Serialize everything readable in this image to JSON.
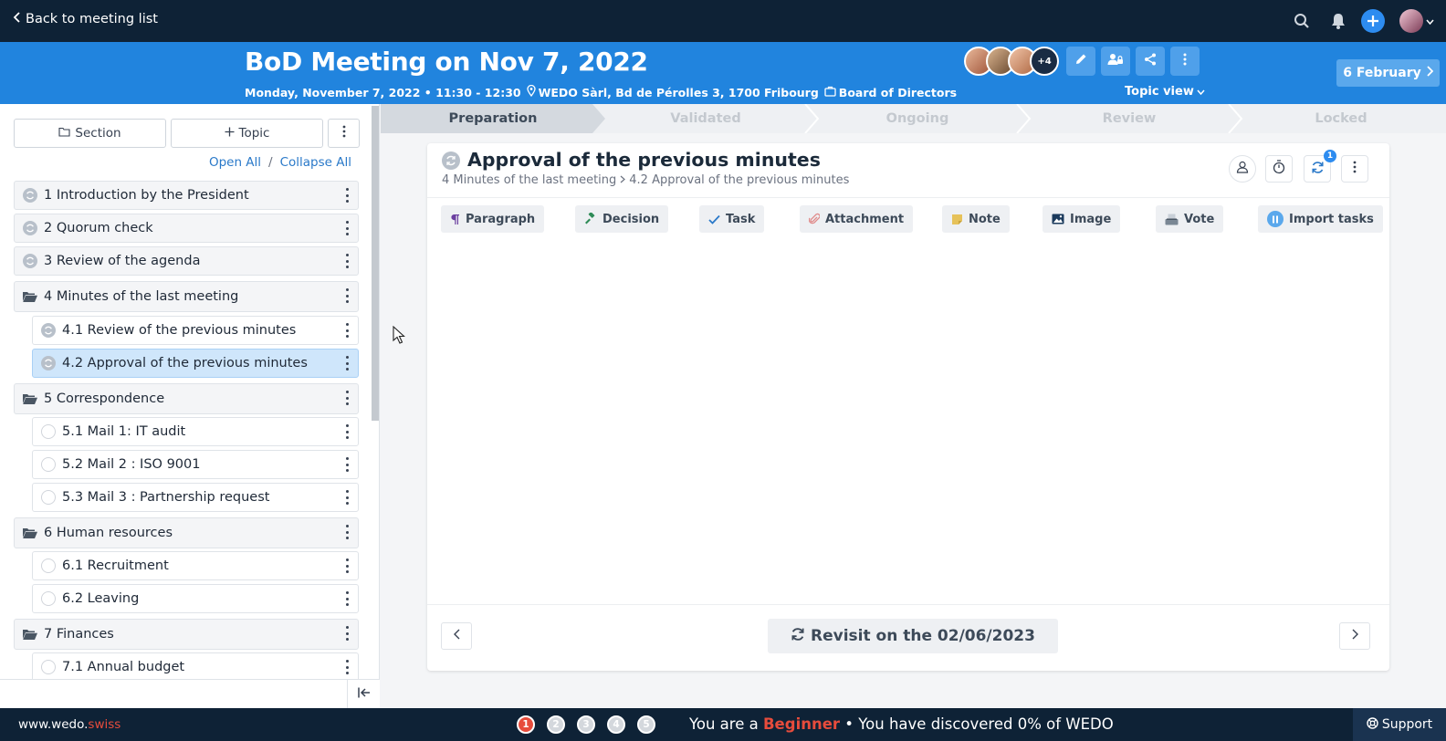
{
  "topbar": {
    "back_label": "Back to meeting list"
  },
  "header": {
    "title": "BoD Meeting on Nov 7, 2022",
    "date_time": "Monday, November 7, 2022 • 11:30 - 12:30",
    "location": "WEDO Sàrl, Bd de Pérolles 3, 1700 Fribourg",
    "group": "Board of Directors",
    "more_attendees": "+4",
    "view_selector": "Topic view",
    "next_meeting": "6 February"
  },
  "sidebar": {
    "section_button": "Section",
    "topic_button": "Topic",
    "open_all": "Open All",
    "separator": "/",
    "collapse_all": "Collapse All",
    "items": [
      {
        "label": "1 Introduction by the President",
        "kind": "topic",
        "icon": "cycle-icon",
        "level": 0
      },
      {
        "label": "2 Quorum check",
        "kind": "topic",
        "icon": "cycle-icon",
        "level": 0
      },
      {
        "label": "3 Review of the agenda",
        "kind": "topic",
        "icon": "cycle-icon",
        "level": 0
      },
      {
        "label": "4 Minutes of the last meeting",
        "kind": "section",
        "icon": "folder-open-icon",
        "level": 0
      },
      {
        "label": "4.1 Review of the previous minutes",
        "kind": "topic",
        "icon": "cycle-icon",
        "level": 1
      },
      {
        "label": "4.2 Approval of the previous minutes",
        "kind": "topic",
        "icon": "cycle-icon",
        "level": 1,
        "active": true
      },
      {
        "label": "5 Correspondence",
        "kind": "section",
        "icon": "folder-open-icon",
        "level": 0
      },
      {
        "label": "5.1 Mail 1: IT audit",
        "kind": "topic",
        "icon": "circle-icon",
        "level": 1
      },
      {
        "label": "5.2 Mail 2 : ISO 9001",
        "kind": "topic",
        "icon": "circle-icon",
        "level": 1
      },
      {
        "label": "5.3 Mail 3 : Partnership request",
        "kind": "topic",
        "icon": "circle-icon",
        "level": 1
      },
      {
        "label": "6 Human resources",
        "kind": "section",
        "icon": "folder-open-icon",
        "level": 0
      },
      {
        "label": "6.1 Recruitment",
        "kind": "topic",
        "icon": "circle-icon",
        "level": 1
      },
      {
        "label": "6.2 Leaving",
        "kind": "topic",
        "icon": "circle-icon",
        "level": 1
      },
      {
        "label": "7 Finances",
        "kind": "section",
        "icon": "folder-open-icon",
        "level": 0
      },
      {
        "label": "7.1 Annual budget",
        "kind": "topic",
        "icon": "circle-icon",
        "level": 1
      }
    ]
  },
  "stages": {
    "items": [
      "Preparation",
      "Validated",
      "Ongoing",
      "Review",
      "Locked"
    ],
    "current": "Preparation"
  },
  "topic": {
    "title": "Approval of the previous minutes",
    "breadcrumb_parent": "4 Minutes of the last meeting",
    "breadcrumb_current": "4.2 Approval of the previous minutes",
    "notification_count": "1",
    "tools": [
      {
        "label": "Paragraph",
        "icon": "paragraph-icon",
        "color": "#6b3fa0"
      },
      {
        "label": "Decision",
        "icon": "gavel-icon",
        "color": "#2e8b57"
      },
      {
        "label": "Task",
        "icon": "check-icon",
        "color": "#2a79c9"
      },
      {
        "label": "Attachment",
        "icon": "paperclip-icon",
        "color": "#e08a8a"
      },
      {
        "label": "Note",
        "icon": "note-icon",
        "color": "#e6c25a"
      },
      {
        "label": "Image",
        "icon": "image-icon",
        "color": "#1b3a5c"
      },
      {
        "label": "Vote",
        "icon": "ballot-icon",
        "color": "#7a8794"
      },
      {
        "label": "Import tasks",
        "icon": "import-icon",
        "color": "#5aa8ec"
      }
    ],
    "revisit_label": "Revisit on the 02/06/2023"
  },
  "footer": {
    "site_prefix": "www.wedo.",
    "site_suffix": "swiss",
    "steps": [
      "1",
      "2",
      "3",
      "4",
      "5"
    ],
    "level_prefix": "You are a",
    "level_name": "Beginner",
    "level_suffix": "• You have discovered 0% of WEDO",
    "support_label": "Support"
  },
  "colors": {
    "brand_dark": "#0e2236",
    "brand_blue": "#2184de",
    "accent_red": "#e74c3c",
    "active_row": "#cfe6fb"
  }
}
